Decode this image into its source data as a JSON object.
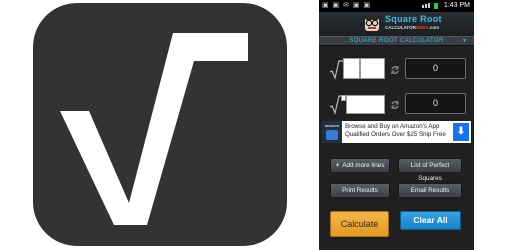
{
  "app_icon": {
    "name": "square-root-icon"
  },
  "status_bar": {
    "time": "1:43 PM",
    "left_icons": "▣ ▣ ✉ ▣ ▣"
  },
  "header": {
    "title": "Square Root",
    "sub_prefix": "CALCULATOR",
    "sub_accent": "GEEK",
    "sub_suffix": ".com"
  },
  "tab": {
    "title": "SQUARE ROOT CALCULATOR",
    "arrow": "▼"
  },
  "rows": [
    {
      "result": "0"
    },
    {
      "result": "0"
    }
  ],
  "ad": {
    "logo_text": "amazon",
    "text": "Browse and Buy on Amazon's App Qualified Orders Over $25 Ship Free",
    "download_glyph": "⬇"
  },
  "buttons": {
    "add_more_lines": "Add more lines",
    "add_more_lines_glyph": "+",
    "list_perfect_squares": "List of Perfect Squares",
    "print_results": "Print Results",
    "email_results": "Email Results",
    "calculate": "Calculate",
    "clear_all": "Clear All"
  },
  "colors": {
    "accent": "#3fb8e6",
    "calculate": "#f0ad3e",
    "clear": "#2592d6",
    "icon_bg": "#333333"
  }
}
